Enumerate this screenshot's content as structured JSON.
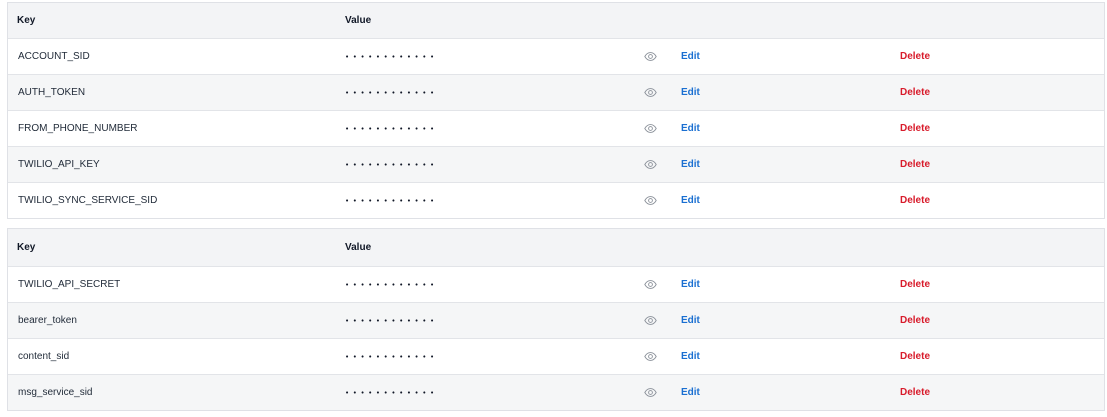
{
  "headers": {
    "key": "Key",
    "value": "Value"
  },
  "mask": "••••••••••••",
  "actions": {
    "edit": "Edit",
    "delete": "Delete"
  },
  "icons": {
    "reveal": "eye-icon"
  },
  "colors": {
    "edit": "#1a6fd1",
    "delete": "#d81b2b",
    "header_bg": "#f3f4f6",
    "alt_row_bg": "#f5f6f7",
    "border": "#dfe1e6"
  },
  "table1": {
    "rows": [
      {
        "key": "ACCOUNT_SID"
      },
      {
        "key": "AUTH_TOKEN"
      },
      {
        "key": "FROM_PHONE_NUMBER"
      },
      {
        "key": "TWILIO_API_KEY"
      },
      {
        "key": "TWILIO_SYNC_SERVICE_SID"
      }
    ]
  },
  "table2": {
    "rows": [
      {
        "key": "TWILIO_API_SECRET"
      },
      {
        "key": "bearer_token"
      },
      {
        "key": "content_sid"
      },
      {
        "key": "msg_service_sid"
      }
    ]
  }
}
